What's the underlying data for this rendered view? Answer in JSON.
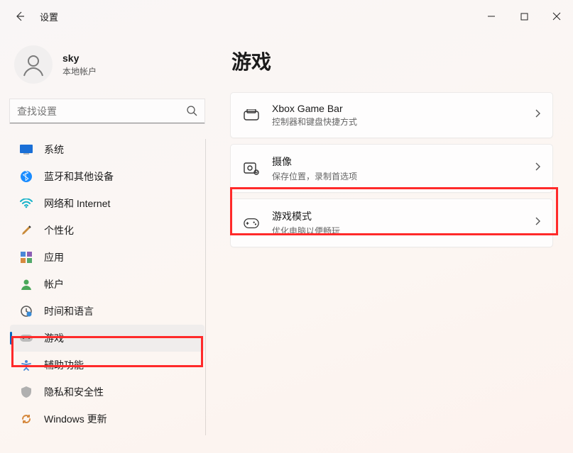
{
  "app": {
    "title": "设置"
  },
  "user": {
    "name": "sky",
    "type": "本地帐户"
  },
  "search": {
    "placeholder": "查找设置"
  },
  "sidebar": {
    "items": [
      {
        "label": "系统"
      },
      {
        "label": "蓝牙和其他设备"
      },
      {
        "label": "网络和 Internet"
      },
      {
        "label": "个性化"
      },
      {
        "label": "应用"
      },
      {
        "label": "帐户"
      },
      {
        "label": "时间和语言"
      },
      {
        "label": "游戏"
      },
      {
        "label": "辅助功能"
      },
      {
        "label": "隐私和安全性"
      },
      {
        "label": "Windows 更新"
      }
    ]
  },
  "page": {
    "title": "游戏"
  },
  "cards": [
    {
      "title": "Xbox Game Bar",
      "sub": "控制器和键盘快捷方式"
    },
    {
      "title": "摄像",
      "sub": "保存位置，录制首选项"
    },
    {
      "title": "游戏模式",
      "sub": "优化电脑以便畅玩"
    }
  ]
}
